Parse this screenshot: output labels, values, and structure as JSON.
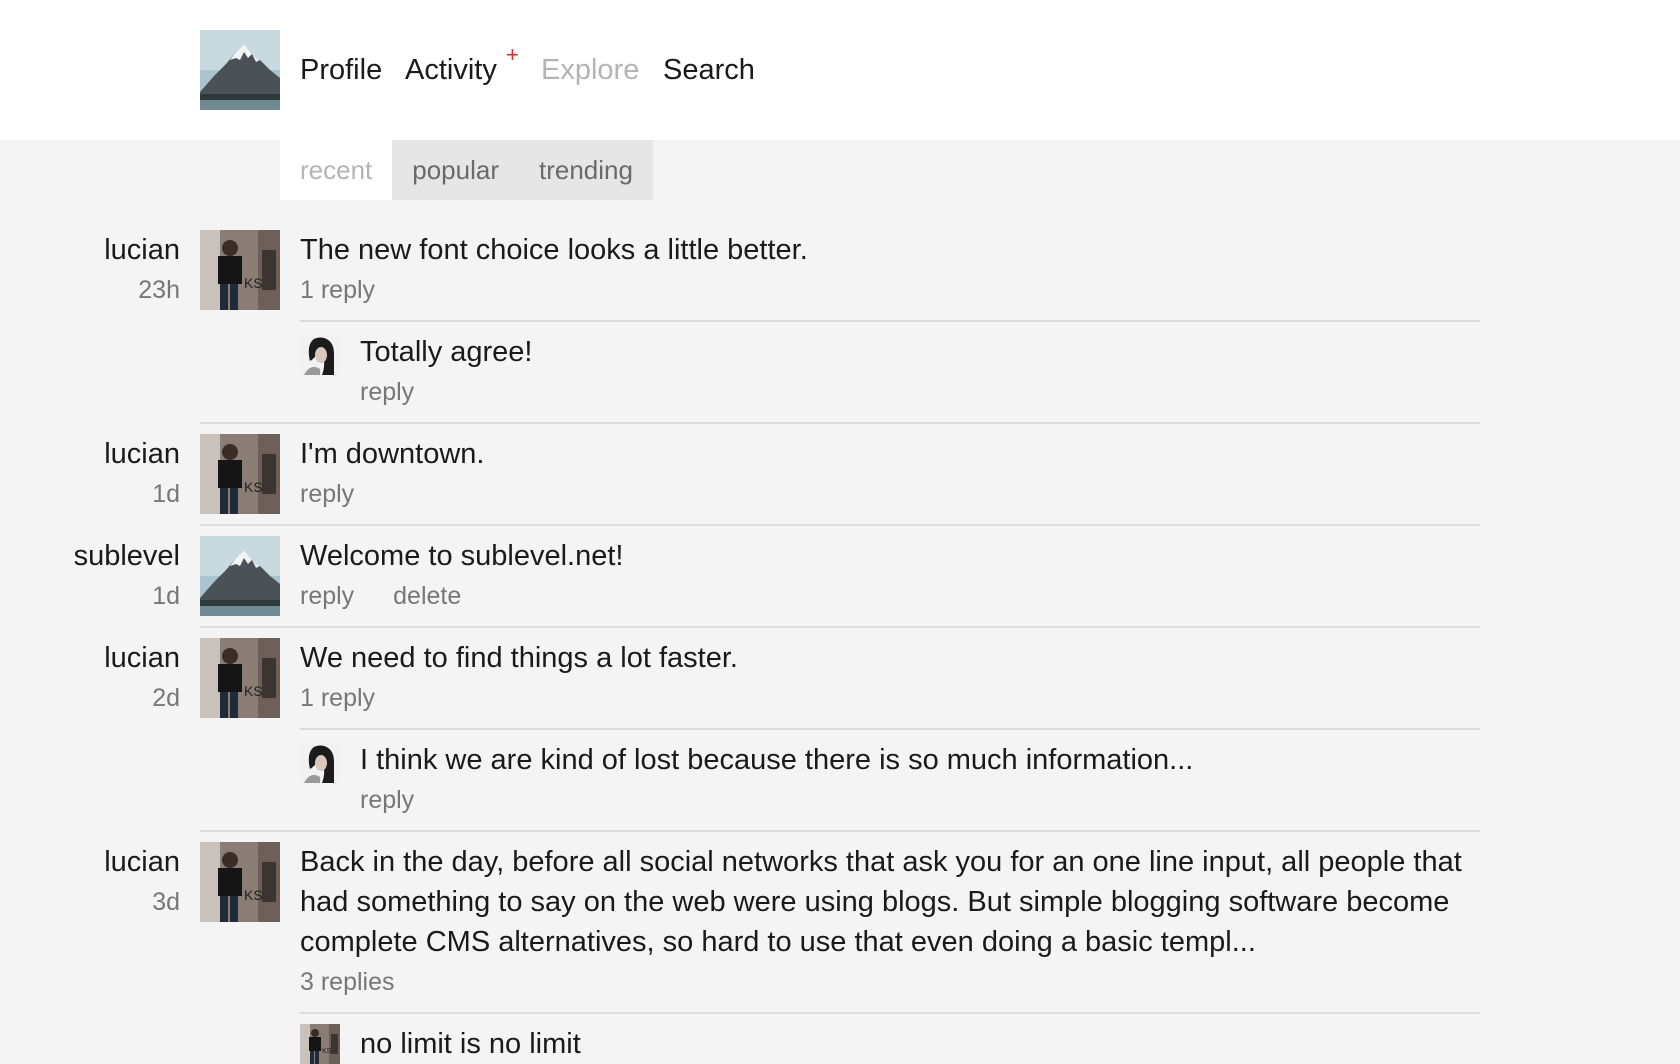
{
  "nav": {
    "profile": "Profile",
    "activity": "Activity",
    "activity_badge": "+",
    "explore": "Explore",
    "search": "Search"
  },
  "tabs": [
    "recent",
    "popular",
    "trending"
  ],
  "active_tab": "recent",
  "posts": [
    {
      "user": "lucian",
      "time": "23h",
      "text": "The new font choice looks a little better.",
      "actions": [
        "1 reply"
      ],
      "reply": {
        "text": "Totally agree!",
        "action": "reply"
      }
    },
    {
      "user": "lucian",
      "time": "1d",
      "text": "I'm downtown.",
      "actions": [
        "reply"
      ]
    },
    {
      "user": "sublevel",
      "time": "1d",
      "text": "Welcome to sublevel.net!",
      "actions": [
        "reply",
        "delete"
      ]
    },
    {
      "user": "lucian",
      "time": "2d",
      "text": "We need to find things a lot faster.",
      "actions": [
        "1 reply"
      ],
      "reply": {
        "text": "I think we are kind of lost because there is so much information...",
        "action": "reply"
      }
    },
    {
      "user": "lucian",
      "time": "3d",
      "text": "Back in the day, before all social networks that ask you for an one line input, all people that had something to say on the web were using blogs. But simple blogging software become complete CMS alternatives, so hard to use that even doing a basic templ...",
      "actions": [
        "3 replies"
      ],
      "reply": {
        "text": "no limit is no limit",
        "action": ""
      }
    }
  ],
  "colors": {
    "background": "#f4f4f4",
    "header": "#ffffff",
    "badge": "#d0312d",
    "muted": "#777777"
  }
}
